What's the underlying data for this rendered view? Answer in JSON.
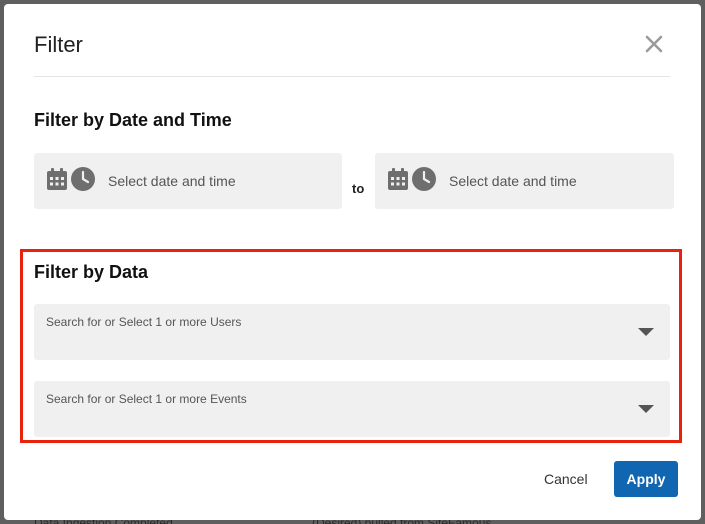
{
  "backdrop": {
    "text_left": "Data Ingestion Completed",
    "text_right": "(Desired) pulled from SiteFamous"
  },
  "modal": {
    "title": "Filter",
    "close_icon": "close-icon"
  },
  "date_section": {
    "title": "Filter by Date and Time",
    "start_placeholder": "Select date and time",
    "to_label": "to",
    "end_placeholder": "Select date and time"
  },
  "data_section": {
    "title": "Filter by Data",
    "users_placeholder": "Search for or Select 1 or more Users",
    "events_placeholder": "Search for or Select 1 or more Events"
  },
  "footer": {
    "cancel_label": "Cancel",
    "apply_label": "Apply"
  },
  "colors": {
    "apply": "#1166b2",
    "highlight": "#e8220c",
    "field_bg": "#f0f0f0"
  }
}
